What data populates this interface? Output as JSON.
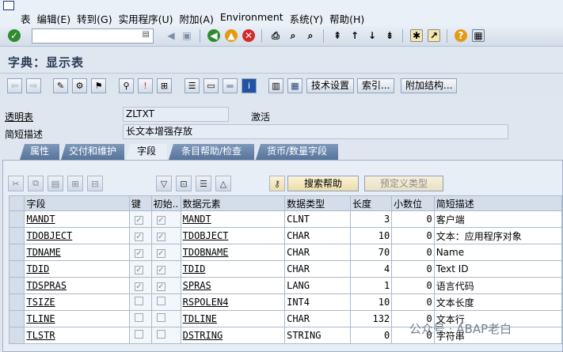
{
  "menu": {
    "items": [
      "表",
      "编辑(E)",
      "转到(G)",
      "实用程序(U)",
      "附加(A)",
      "Environment",
      "系统(Y)",
      "帮助(H)"
    ]
  },
  "title": "字典：显示表",
  "app_toolbar": {
    "tech_settings": "技术设置",
    "indexes": "索引...",
    "append_structure": "附加结构..."
  },
  "header": {
    "transparent_table_label": "透明表",
    "table_name": "ZLTXT",
    "status": "激活",
    "short_desc_label": "简短描述",
    "short_desc_value": "长文本增强存放"
  },
  "tabs": [
    "属性",
    "交付和维护",
    "字段",
    "条目帮助/检查",
    "货币/数量字段"
  ],
  "active_tab": "字段",
  "field_toolbar": {
    "search_help": "搜索帮助",
    "predefined_type": "预定义类型"
  },
  "columns": [
    "字段",
    "键",
    "初始..",
    "数据元素",
    "数据类型",
    "长度",
    "小数位",
    "简短描述"
  ],
  "rows": [
    {
      "field": "MANDT",
      "key": true,
      "initial": true,
      "element": "MANDT",
      "type": "CLNT",
      "length": "3",
      "decimals": "0",
      "desc": "客户端"
    },
    {
      "field": "TDOBJECT",
      "key": true,
      "initial": true,
      "element": "TDOBJECT",
      "type": "CHAR",
      "length": "10",
      "decimals": "0",
      "desc": "文本：应用程序对象"
    },
    {
      "field": "TDNAME",
      "key": true,
      "initial": true,
      "element": "TDOBNAME",
      "type": "CHAR",
      "length": "70",
      "decimals": "0",
      "desc": "Name"
    },
    {
      "field": "TDID",
      "key": true,
      "initial": true,
      "element": "TDID",
      "type": "CHAR",
      "length": "4",
      "decimals": "0",
      "desc": "Text ID"
    },
    {
      "field": "TDSPRAS",
      "key": true,
      "initial": true,
      "element": "SPRAS",
      "type": "LANG",
      "length": "1",
      "decimals": "0",
      "desc": "语言代码"
    },
    {
      "field": "TSIZE",
      "key": false,
      "initial": false,
      "element": "RSPOLEN4",
      "type": "INT4",
      "length": "10",
      "decimals": "0",
      "desc": "文本长度"
    },
    {
      "field": "TLINE",
      "key": false,
      "initial": false,
      "element": "TDLINE",
      "type": "CHAR",
      "length": "132",
      "decimals": "0",
      "desc": "文本行"
    },
    {
      "field": "TLSTR",
      "key": false,
      "initial": false,
      "element": "DSTRING",
      "type": "STRING",
      "length": "0",
      "decimals": "0",
      "desc": "字符串"
    }
  ],
  "watermark": "公众号 · ABAP老白"
}
